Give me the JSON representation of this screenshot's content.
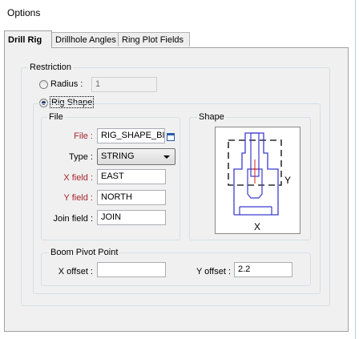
{
  "window": {
    "title": "Options"
  },
  "tabs": [
    {
      "label": "Drill Rig",
      "active": true
    },
    {
      "label": "Drillhole Angles",
      "active": false
    },
    {
      "label": "Ring Plot Fields",
      "active": false
    }
  ],
  "restriction": {
    "group_label": "Restriction",
    "radius": {
      "label": "Radius :",
      "value": "1",
      "selected": false
    },
    "rig_shape": {
      "label": "Rig Shape",
      "selected": true
    }
  },
  "file_group": {
    "label": "File",
    "file": {
      "label": "File :",
      "value": "RIG_SHAPE_BIG"
    },
    "type": {
      "label": "Type :",
      "value": "STRING"
    },
    "x_field": {
      "label": "X field :",
      "value": "EAST"
    },
    "y_field": {
      "label": "Y field :",
      "value": "NORTH"
    },
    "join_field": {
      "label": "Join field :",
      "value": "JOIN"
    }
  },
  "shape_group": {
    "label": "Shape",
    "x_axis_label": "X",
    "y_axis_label": "Y",
    "colors": {
      "outline": "#3b3bd0",
      "guide": "#000000",
      "pivot": "#d02020"
    }
  },
  "boom_pivot": {
    "label": "Boom Pivot Point",
    "x_offset": {
      "label": "X offset :",
      "value": ""
    },
    "y_offset": {
      "label": "Y offset :",
      "value": "2.2"
    }
  }
}
